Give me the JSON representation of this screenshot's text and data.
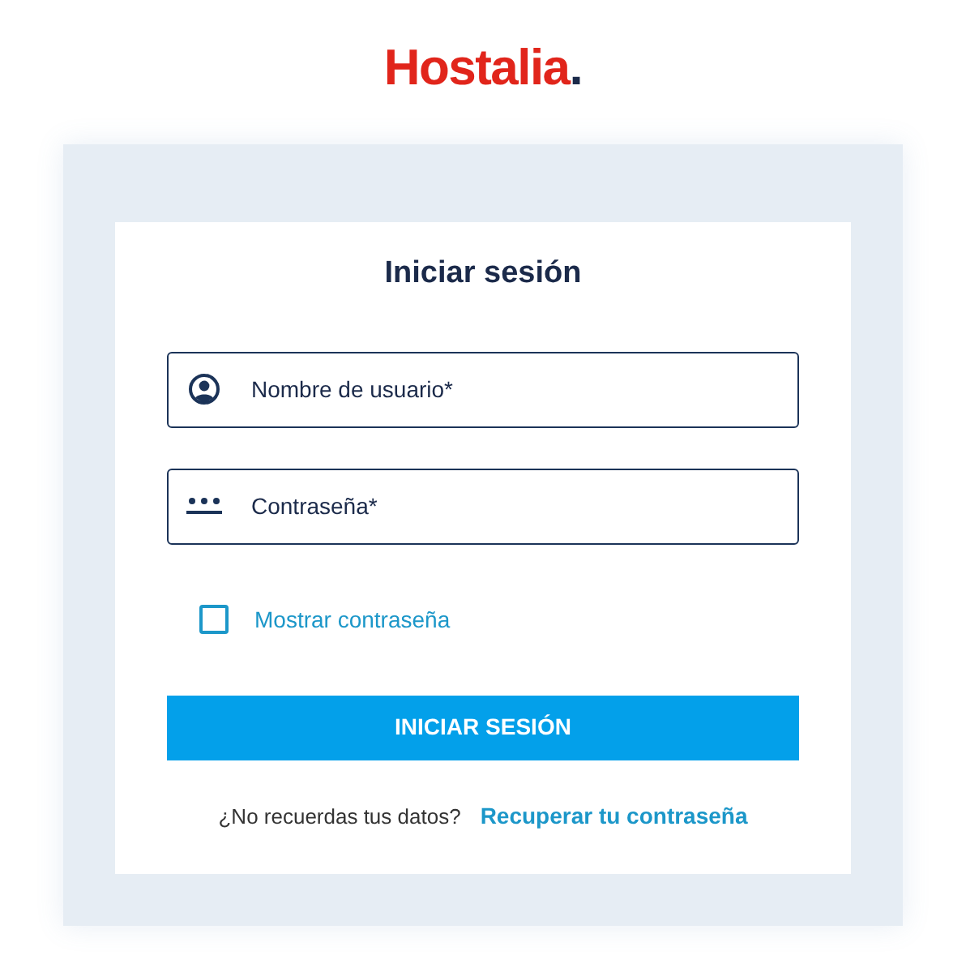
{
  "logo": {
    "text": "Hostalia",
    "mark": "."
  },
  "title": "Iniciar sesión",
  "fields": [
    {
      "kind": "user",
      "placeholder": "Nombre de usuario*"
    },
    {
      "kind": "password",
      "placeholder": "Contraseña*"
    }
  ],
  "show_password": {
    "label": "Mostrar contraseña",
    "checked": false
  },
  "submit": "INICIAR SESIÓN",
  "recover": {
    "prompt": "¿No recuerdas tus datos?",
    "link": "Recuperar tu contraseña"
  }
}
